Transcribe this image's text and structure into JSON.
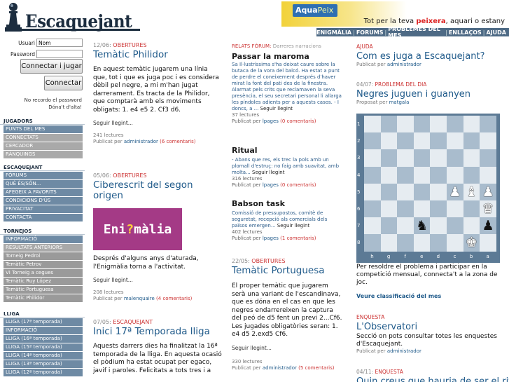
{
  "header": {
    "logo_text": "Escaquejant",
    "ad_logo": "Aqua",
    "ad_logo_suffix": "Peix",
    "ad_text_pre": "Tot per la teva ",
    "ad_text_bold": "peixera",
    "ad_text_post": ", aquari o estany",
    "nav": [
      "ENIGMÀLIA",
      "FORUMS",
      "PROBLEMES DEL MES",
      "ENLLAÇOS",
      "AJUDA"
    ]
  },
  "login": {
    "user_label": "Usuari",
    "user_value": "Nom",
    "pass_label": "Password",
    "login_button": "Connectar i jugar",
    "connect_button": "Connectar",
    "forgot_line1": "No recordo el password",
    "forgot_line2": "Dóna't d'alta!"
  },
  "sidebar": {
    "jugadors": {
      "title": "JUGADORS",
      "items": [
        "PUNTS DEL MES",
        "CONNECTATS",
        "CERCADOR",
        "RÀNQUINGS"
      ]
    },
    "escaquejant": {
      "title": "ESCAQUEJANT",
      "items": [
        "FÒRUMS",
        "QUÈ ÉS/SÓN...",
        "AFEGEIX A FAVORITS",
        "CONDICIONS D'ÚS",
        "PRIVACITAT",
        "CONTACTA"
      ]
    },
    "tornejos": {
      "title": "TORNEJOS",
      "items": [
        "INFORMACIÓ",
        "RESULTATS ANTERIORS"
      ],
      "subitems": [
        "Torneig Pedrol",
        "Temàtic Petrov",
        "VI Torneig a cegues",
        "Temàtic Ruy López",
        "Temàtic Portuguesa",
        "Temàtic Philidor"
      ]
    },
    "lliga": {
      "title": "LLIGA",
      "items": [
        "LLIGA (17ª temporada)",
        "INFORMACIÓ",
        "LLIGA (16ª temporada)",
        "LLIGA (15ª temporada)",
        "LLIGA (14ª temporada)",
        "LLIGA (13ª temporada)",
        "LLIGA (12ª temporada)"
      ]
    }
  },
  "articles": [
    {
      "date": "12/06: ",
      "category": "OBERTURES",
      "title": "Temàtic Philidor",
      "body": "En aquest temàtic jugarem una línia que, tot i que es juga poc i es considera dèbil pel negre, a mi m'han jugat darrerament. Es tracta de la Philidor, que comptarà amb els moviments obligats: 1. e4 e5 2. Cf3 d6.",
      "more": "Seguir llegint...",
      "reads": "241 lectures",
      "published_by": "Publicat per ",
      "author": "administrador",
      "comments": "(6 comentaris)"
    },
    {
      "date": "05/06: ",
      "category": "OBERTURES",
      "title": "Ciberescrit del segon origen",
      "image_text_a": "Eni",
      "image_text_b": "?",
      "image_text_c": "màlia",
      "body": "Després d'alguns anys d'aturada, l'Enigmàlia torna a l'activitat.",
      "more": "Seguir llegint...",
      "reads": "208 lectures",
      "published_by": "Publicat per ",
      "author": "malenquaire",
      "comments": "(4 comentaris)"
    },
    {
      "date": "07/05: ",
      "category": "ESCAQUEJANT",
      "title": "Inici 17ª Temporada lliga",
      "body": "Aquests darrers dies ha finalitzat la 16ª temporada de la lliga. En aquesta ocasió el pòdium ha estat ocupat per egaco, javif i paroles. Felicitats a tots tres i a"
    }
  ],
  "forum": {
    "head": "RELATS FÒRUM: ",
    "head_sub": "Darreres narracions",
    "threads": [
      {
        "title": "Passar la maroma",
        "text": "Sa Il·lustríssima s'ha deixat caure sobre la butaca de la vora del balcó. Ha estat a punt de perdre el coneixement després d'haver mirat la font del pati des de la finestra. Alarmat pels crits que reclamaven la seva presència, el seu secretari personal li allarga les píndoles adients per a aquests casos. - I doncs, a ...",
        "more": "Seguir llegint",
        "reads": "37 lectures",
        "published_by": "Publicat per ",
        "author": "lpages",
        "comments": "(0 comentaris)"
      },
      {
        "title": "Ritual",
        "text": "- Abans que res, els trec la pols amb un plomall d'estruç: no faig amb suavitat, amb molta...",
        "more": "Seguir llegint",
        "reads": "316 lectures",
        "published_by": "Publicat per ",
        "author": "lpages",
        "comments": "(0 comentaris)"
      },
      {
        "title": "Babson task",
        "text": "Comissió de pressupostos, comitè de seguretat, recepció als comercials dels països emergen...",
        "more": "Seguir llegint",
        "reads": "402 lectures",
        "published_by": "Publicat per ",
        "author": "lpages",
        "comments": "(1 comentaris)"
      }
    ]
  },
  "portuguesa": {
    "date": "22/05: ",
    "category": "OBERTURES",
    "title": "Temàtic Portuguesa",
    "body": "El proper temàtic que jugarem serà una variant de l'escandinava, que es dóna en el cas en que les negres endarrereixen la captura del peó de d5 fent un previ 2...Cf6. Les jugades obligatòries seran: 1. e4 d5 2.exd5 Cf6.",
    "more": "Seguir llegint...",
    "reads": "330 lectures",
    "published_by": "Publicat per ",
    "author": "administrador",
    "comments": "(5 comentaris)"
  },
  "right": {
    "ajuda": {
      "head": "AJUDA",
      "title": "Com es juga a Escaquejant?",
      "published_by": "Publicat per ",
      "author": "administrador"
    },
    "problema": {
      "date": "04/07: ",
      "category": "PROBLEMA DEL DIA",
      "title": "Negres juguen i guanyen",
      "published_by": "Proposat per ",
      "author": "matgala",
      "ranks": [
        "1",
        "2",
        "3",
        "4",
        "5",
        "6",
        "7",
        "8"
      ],
      "files": [
        "h",
        "g",
        "f",
        "e",
        "d",
        "c",
        "b",
        "a"
      ],
      "body": "Per resoldre el problema i participar en la competició mensual, connecta't a la zona de joc.",
      "link": "Veure classificació del mes"
    },
    "enquesta": {
      "head": "ENQUESTA",
      "title": "L'Observatori",
      "body": "Secció on pots consultar totes les enquestes d'Escaquejant.",
      "published_by": "Publicat per ",
      "author": "administrador"
    },
    "enquesta2": {
      "date": "04/11: ",
      "category": "ENQUESTA",
      "title": "Quin creus que hauria de ser el ritme"
    }
  }
}
